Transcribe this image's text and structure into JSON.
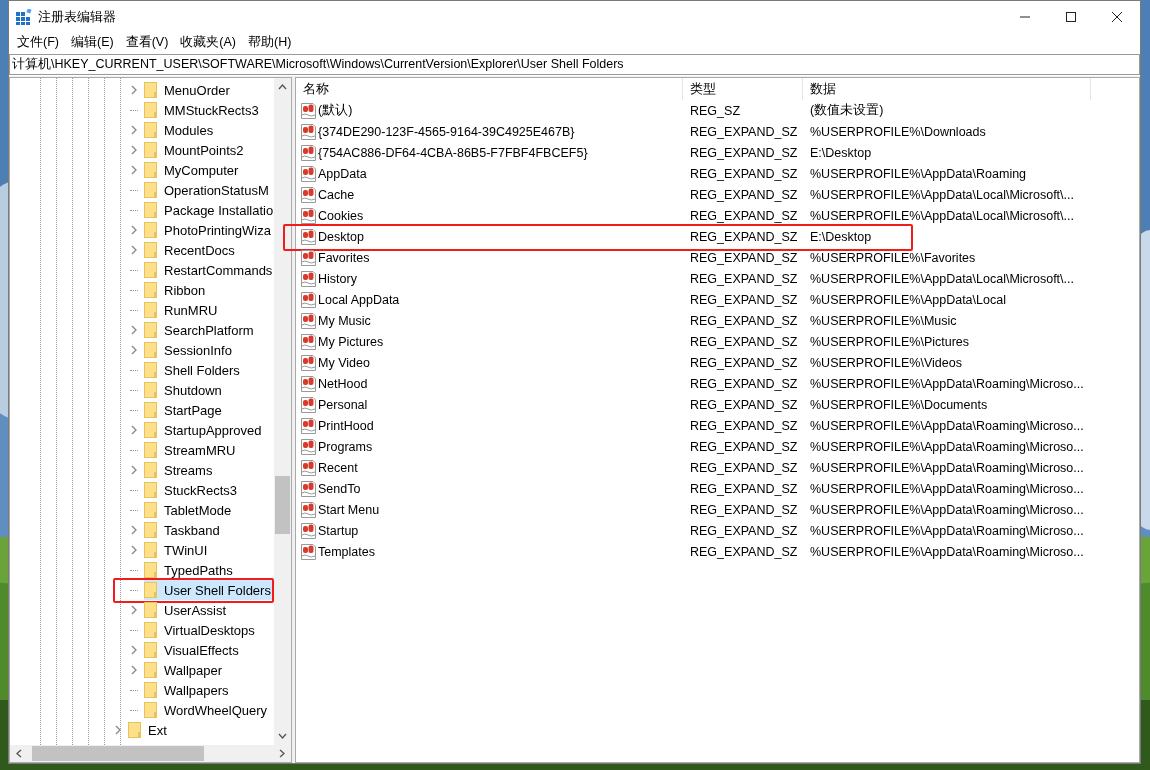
{
  "window": {
    "title": "注册表编辑器"
  },
  "menu": [
    "文件(F)",
    "编辑(E)",
    "查看(V)",
    "收藏夹(A)",
    "帮助(H)"
  ],
  "address": "计算机\\HKEY_CURRENT_USER\\SOFTWARE\\Microsoft\\Windows\\CurrentVersion\\Explorer\\User Shell Folders",
  "tree": {
    "nodes": [
      {
        "children": [
          {
            "label": "MenuOrder",
            "expandable": true,
            "selected": false,
            "highlighted": false
          },
          {
            "label": "MMStuckRects3",
            "expandable": false,
            "selected": false,
            "highlighted": false
          },
          {
            "label": "Modules",
            "expandable": true,
            "selected": false,
            "highlighted": false
          },
          {
            "label": "MountPoints2",
            "expandable": true,
            "selected": false,
            "highlighted": false
          },
          {
            "label": "MyComputer",
            "expandable": true,
            "selected": false,
            "highlighted": false
          },
          {
            "label": "OperationStatusM",
            "expandable": false,
            "selected": false,
            "highlighted": false
          },
          {
            "label": "Package Installatio",
            "expandable": false,
            "selected": false,
            "highlighted": false
          },
          {
            "label": "PhotoPrintingWiza",
            "expandable": true,
            "selected": false,
            "highlighted": false
          },
          {
            "label": "RecentDocs",
            "expandable": true,
            "selected": false,
            "highlighted": false
          },
          {
            "label": "RestartCommands",
            "expandable": false,
            "selected": false,
            "highlighted": false
          },
          {
            "label": "Ribbon",
            "expandable": false,
            "selected": false,
            "highlighted": false
          },
          {
            "label": "RunMRU",
            "expandable": false,
            "selected": false,
            "highlighted": false
          },
          {
            "label": "SearchPlatform",
            "expandable": true,
            "selected": false,
            "highlighted": false
          },
          {
            "label": "SessionInfo",
            "expandable": true,
            "selected": false,
            "highlighted": false
          },
          {
            "label": "Shell Folders",
            "expandable": false,
            "selected": false,
            "highlighted": false
          },
          {
            "label": "Shutdown",
            "expandable": false,
            "selected": false,
            "highlighted": false
          },
          {
            "label": "StartPage",
            "expandable": false,
            "selected": false,
            "highlighted": false
          },
          {
            "label": "StartupApproved",
            "expandable": true,
            "selected": false,
            "highlighted": false
          },
          {
            "label": "StreamMRU",
            "expandable": false,
            "selected": false,
            "highlighted": false
          },
          {
            "label": "Streams",
            "expandable": true,
            "selected": false,
            "highlighted": false
          },
          {
            "label": "StuckRects3",
            "expandable": false,
            "selected": false,
            "highlighted": false
          },
          {
            "label": "TabletMode",
            "expandable": false,
            "selected": false,
            "highlighted": false
          },
          {
            "label": "Taskband",
            "expandable": true,
            "selected": false,
            "highlighted": false
          },
          {
            "label": "TWinUI",
            "expandable": true,
            "selected": false,
            "highlighted": false
          },
          {
            "label": "TypedPaths",
            "expandable": false,
            "selected": false,
            "highlighted": false
          },
          {
            "label": "User Shell Folders",
            "expandable": false,
            "selected": true,
            "highlighted": true
          },
          {
            "label": "UserAssist",
            "expandable": true,
            "selected": false,
            "highlighted": false
          },
          {
            "label": "VirtualDesktops",
            "expandable": false,
            "selected": false,
            "highlighted": false
          },
          {
            "label": "VisualEffects",
            "expandable": true,
            "selected": false,
            "highlighted": false
          },
          {
            "label": "Wallpaper",
            "expandable": true,
            "selected": false,
            "highlighted": false
          },
          {
            "label": "Wallpapers",
            "expandable": false,
            "selected": false,
            "highlighted": false
          },
          {
            "label": "WordWheelQuery",
            "expandable": false,
            "selected": false,
            "highlighted": false
          }
        ]
      },
      {
        "label": "Ext",
        "expandable": true,
        "selected": false,
        "highlighted": false
      }
    ]
  },
  "table": {
    "columns": [
      "名称",
      "类型",
      "数据"
    ],
    "rows": [
      {
        "name": "(默认)",
        "type": "REG_SZ",
        "data": "(数值未设置)",
        "highlighted": false
      },
      {
        "name": "{374DE290-123F-4565-9164-39C4925E467B}",
        "type": "REG_EXPAND_SZ",
        "data": "%USERPROFILE%\\Downloads",
        "highlighted": false
      },
      {
        "name": "{754AC886-DF64-4CBA-86B5-F7FBF4FBCEF5}",
        "type": "REG_EXPAND_SZ",
        "data": "E:\\Desktop",
        "highlighted": false
      },
      {
        "name": "AppData",
        "type": "REG_EXPAND_SZ",
        "data": "%USERPROFILE%\\AppData\\Roaming",
        "highlighted": false
      },
      {
        "name": "Cache",
        "type": "REG_EXPAND_SZ",
        "data": "%USERPROFILE%\\AppData\\Local\\Microsoft\\...",
        "highlighted": false
      },
      {
        "name": "Cookies",
        "type": "REG_EXPAND_SZ",
        "data": "%USERPROFILE%\\AppData\\Local\\Microsoft\\...",
        "highlighted": false
      },
      {
        "name": "Desktop",
        "type": "REG_EXPAND_SZ",
        "data": "E:\\Desktop",
        "highlighted": true
      },
      {
        "name": "Favorites",
        "type": "REG_EXPAND_SZ",
        "data": "%USERPROFILE%\\Favorites",
        "highlighted": false
      },
      {
        "name": "History",
        "type": "REG_EXPAND_SZ",
        "data": "%USERPROFILE%\\AppData\\Local\\Microsoft\\...",
        "highlighted": false
      },
      {
        "name": "Local AppData",
        "type": "REG_EXPAND_SZ",
        "data": "%USERPROFILE%\\AppData\\Local",
        "highlighted": false
      },
      {
        "name": "My Music",
        "type": "REG_EXPAND_SZ",
        "data": "%USERPROFILE%\\Music",
        "highlighted": false
      },
      {
        "name": "My Pictures",
        "type": "REG_EXPAND_SZ",
        "data": "%USERPROFILE%\\Pictures",
        "highlighted": false
      },
      {
        "name": "My Video",
        "type": "REG_EXPAND_SZ",
        "data": "%USERPROFILE%\\Videos",
        "highlighted": false
      },
      {
        "name": "NetHood",
        "type": "REG_EXPAND_SZ",
        "data": "%USERPROFILE%\\AppData\\Roaming\\Microso...",
        "highlighted": false
      },
      {
        "name": "Personal",
        "type": "REG_EXPAND_SZ",
        "data": "%USERPROFILE%\\Documents",
        "highlighted": false
      },
      {
        "name": "PrintHood",
        "type": "REG_EXPAND_SZ",
        "data": "%USERPROFILE%\\AppData\\Roaming\\Microso...",
        "highlighted": false
      },
      {
        "name": "Programs",
        "type": "REG_EXPAND_SZ",
        "data": "%USERPROFILE%\\AppData\\Roaming\\Microso...",
        "highlighted": false
      },
      {
        "name": "Recent",
        "type": "REG_EXPAND_SZ",
        "data": "%USERPROFILE%\\AppData\\Roaming\\Microso...",
        "highlighted": false
      },
      {
        "name": "SendTo",
        "type": "REG_EXPAND_SZ",
        "data": "%USERPROFILE%\\AppData\\Roaming\\Microso...",
        "highlighted": false
      },
      {
        "name": "Start Menu",
        "type": "REG_EXPAND_SZ",
        "data": "%USERPROFILE%\\AppData\\Roaming\\Microso...",
        "highlighted": false
      },
      {
        "name": "Startup",
        "type": "REG_EXPAND_SZ",
        "data": "%USERPROFILE%\\AppData\\Roaming\\Microso...",
        "highlighted": false
      },
      {
        "name": "Templates",
        "type": "REG_EXPAND_SZ",
        "data": "%USERPROFILE%\\AppData\\Roaming\\Microso...",
        "highlighted": false
      }
    ]
  }
}
